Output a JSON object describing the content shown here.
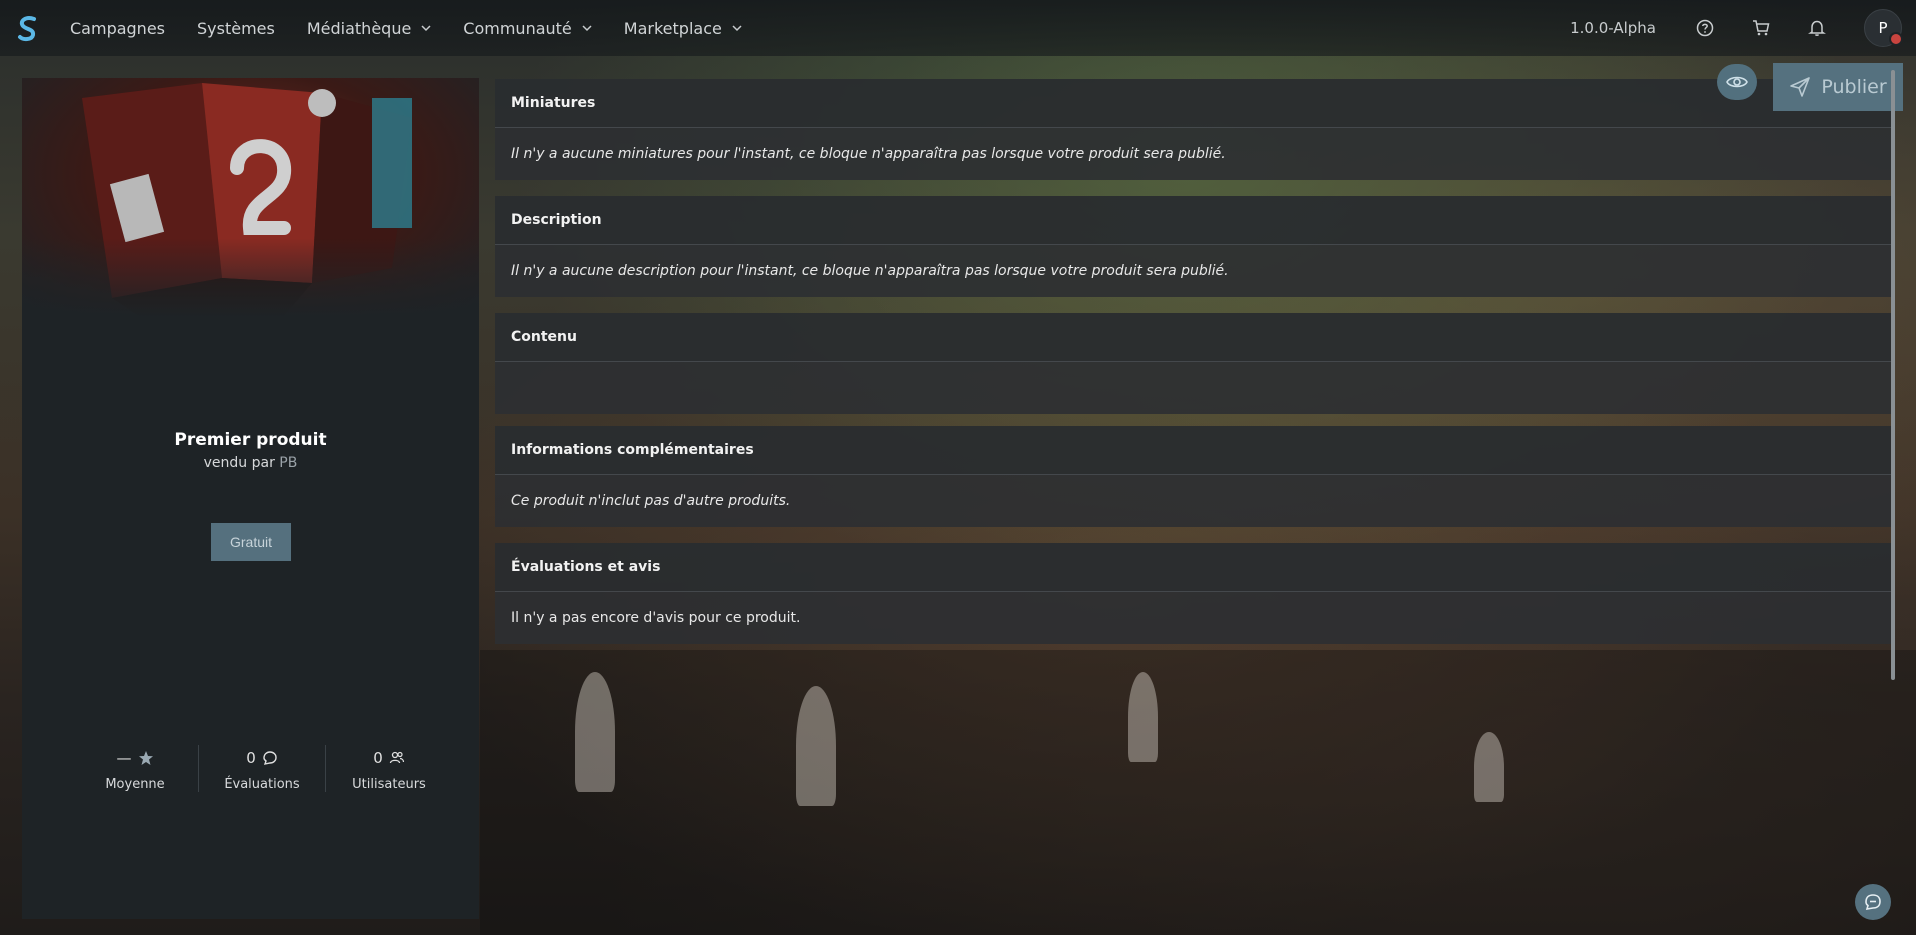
{
  "nav": {
    "items": [
      {
        "label": "Campagnes",
        "has_dropdown": false
      },
      {
        "label": "Systèmes",
        "has_dropdown": false
      },
      {
        "label": "Médiathèque",
        "has_dropdown": true
      },
      {
        "label": "Communauté",
        "has_dropdown": true
      },
      {
        "label": "Marketplace",
        "has_dropdown": true
      }
    ],
    "version": "1.0.0-Alpha",
    "icons": [
      "help-icon",
      "cart-icon",
      "bell-icon"
    ],
    "avatar_initial": "P"
  },
  "actions": {
    "preview_icon": "eye-icon",
    "publish_label": "Publier",
    "publish_icon": "send-icon"
  },
  "product": {
    "title": "Premier produit",
    "seller_prefix": "vendu par",
    "seller_name": "PB",
    "price_label": "Gratuit",
    "stats": [
      {
        "value": "—",
        "icon": "star-icon",
        "label": "Moyenne"
      },
      {
        "value": "0",
        "icon": "comment-icon",
        "label": "Évaluations"
      },
      {
        "value": "0",
        "icon": "users-icon",
        "label": "Utilisateurs"
      }
    ]
  },
  "sections": [
    {
      "title": "Miniatures",
      "body": "Il n'y a aucune miniatures pour l'instant, ce bloque n'apparaîtra pas lorsque votre produit sera publié."
    },
    {
      "title": "Description",
      "body": "Il n'y a aucune description pour l'instant, ce bloque n'apparaîtra pas lorsque votre produit sera publié."
    },
    {
      "title": "Contenu",
      "body": ""
    },
    {
      "title": "Informations complémentaires",
      "body": "Ce produit n'inclut pas d'autre produits."
    },
    {
      "title": "Évaluations et avis",
      "body": "Il n'y a pas encore d'avis pour ce produit."
    }
  ],
  "colors": {
    "accent": "#55717f",
    "panel": "#1e2326",
    "notification_dot": "#c9443f"
  }
}
